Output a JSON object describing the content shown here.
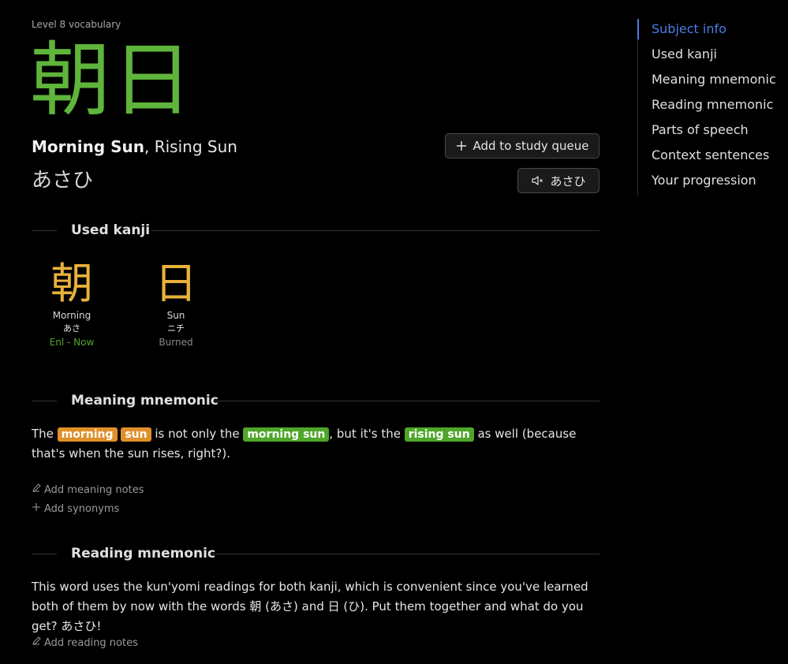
{
  "subject": {
    "level_label": "Level 8 vocabulary",
    "characters": "朝日",
    "primary_meaning": "Morning Sun",
    "other_meanings": ", Rising Sun",
    "reading": "あさひ",
    "color": "#5fb53b"
  },
  "actions": {
    "add_queue_label": "Add to study queue",
    "audio_label": "あさひ"
  },
  "sections": {
    "used_kanji": "Used kanji",
    "meaning_mnemonic": "Meaning mnemonic",
    "reading_mnemonic": "Reading mnemonic"
  },
  "used_kanji": [
    {
      "glyph": "朝",
      "meaning": "Morning",
      "reading": "あさ",
      "status": "Enl - Now",
      "status_color": "#4ea62a"
    },
    {
      "glyph": "日",
      "meaning": "Sun",
      "reading": "ニチ",
      "status": "Burned",
      "status_color": "#8a8a8a"
    }
  ],
  "meaning_mnemonic": {
    "t1": "The ",
    "tag1": "morning",
    "tag2": "sun",
    "t2": " is not only the ",
    "tag3": "morning sun",
    "t3": ", but it's the ",
    "tag4": "rising sun",
    "t4": " as well (because that's when the sun rises, right?)."
  },
  "meaning_links": {
    "add_notes": "Add meaning notes",
    "add_synonyms": "Add synonyms"
  },
  "reading_mnemonic": {
    "text": "This word uses the kun'yomi readings for both kanji, which is convenient since you've learned both of them by now with the words 朝 (あさ) and 日 (ひ). Put them together and what do you get? あさひ!"
  },
  "reading_links": {
    "add_notes": "Add reading notes"
  },
  "toc": [
    "Subject info",
    "Used kanji",
    "Meaning mnemonic",
    "Reading mnemonic",
    "Parts of speech",
    "Context sentences",
    "Your progression"
  ],
  "colors": {
    "vocabulary": "#5fb53b",
    "kanji": "#e8b23a",
    "highlight_reading": "#e0902a",
    "highlight_vocab": "#4ea62a",
    "toc_active": "#4c7de6"
  }
}
